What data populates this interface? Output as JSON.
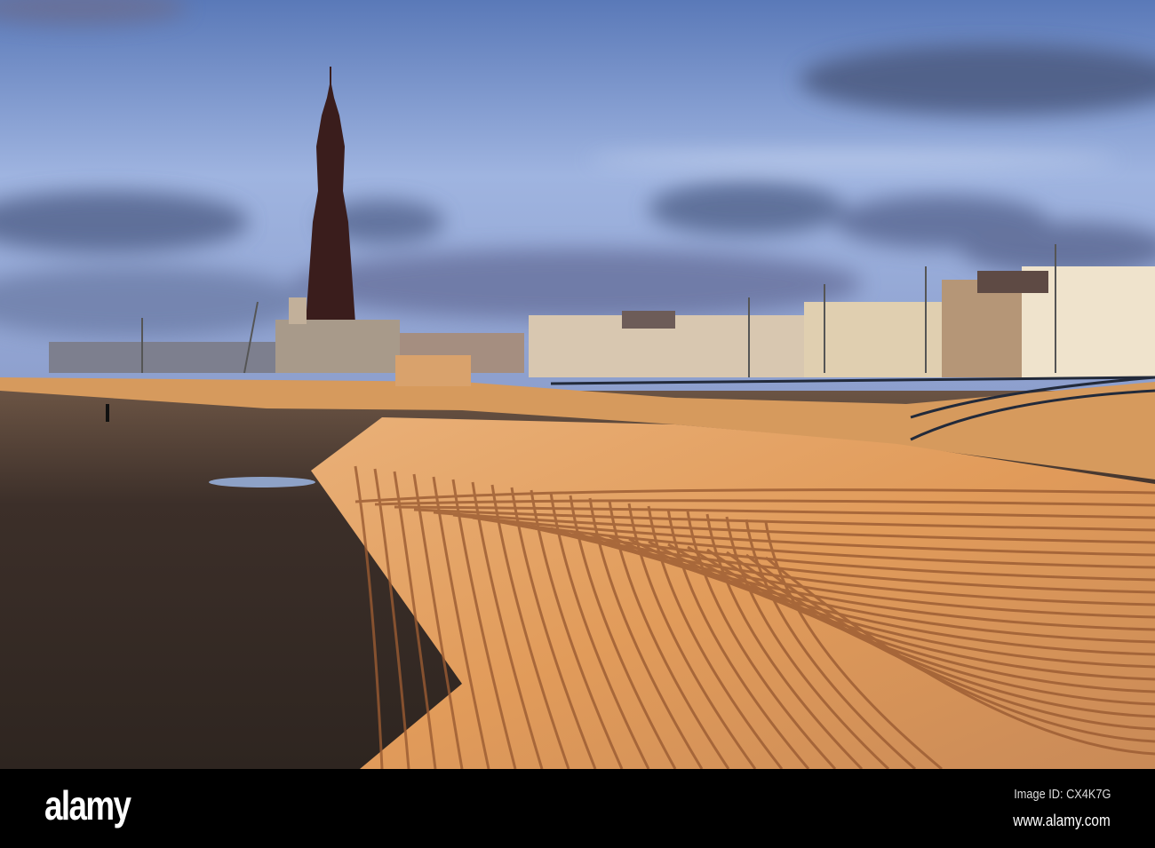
{
  "photo": {
    "subject": "Blackpool Tower and seafront steps",
    "colors": {
      "sky_top": "#5f7fbf",
      "sky_low": "#a9bde6",
      "cloud": "#5a6a92",
      "steps": "#e3a060",
      "sand": "#3a2e28"
    }
  },
  "watermark": {
    "logo": "alamy",
    "image_id": "Image ID: CX4K7G",
    "site": "www.alamy.com"
  }
}
